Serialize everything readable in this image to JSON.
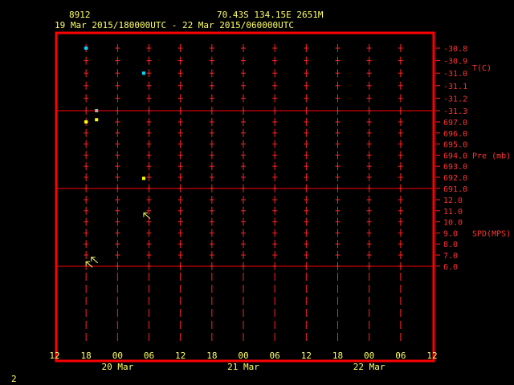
{
  "header": {
    "station_id": "8912",
    "location": "70.43S   134.15E   2651M",
    "time_range": "19 Mar 2015/180000UTC - 22 Mar 2015/060000UTC"
  },
  "footer": {
    "page_number": "2"
  },
  "colors": {
    "frame": "#ff0000",
    "header_text": "#ffff66",
    "temperature_point": "#00d8ff",
    "pressure_point": "#ffff00",
    "temperature_gray": "#aaaaaa",
    "wind_arrow": "#ffff66"
  },
  "chart_data": {
    "type": "scatter",
    "x_axis": {
      "unit": "hour (UTC)",
      "start": "2015-03-19 12:00",
      "end": "2015-03-22 12:00",
      "tick_labels": [
        "12",
        "18",
        "00",
        "06",
        "12",
        "18",
        "00",
        "06",
        "12",
        "18",
        "00",
        "06",
        "12"
      ],
      "date_labels": [
        "20 Mar",
        "21 Mar",
        "22 Mar"
      ]
    },
    "panels": [
      {
        "name": "temperature",
        "label": "T(C)",
        "tick_labels": [
          "-30.8",
          "-30.9",
          "-31.0",
          "-31.1",
          "-31.2",
          "-31.3"
        ],
        "ylim": [
          -31.3,
          -30.8
        ],
        "points": [
          {
            "x": "2015-03-19 18:00",
            "y": -30.8,
            "color": "#00d8ff"
          },
          {
            "x": "2015-03-20 05:00",
            "y": -31.0,
            "color": "#00d8ff"
          },
          {
            "x": "2015-03-19 20:00",
            "y": -31.3,
            "color": "#aaaaaa"
          }
        ]
      },
      {
        "name": "pressure",
        "label": "Pre (mb)",
        "tick_labels": [
          "697.0",
          "696.0",
          "695.0",
          "694.0",
          "693.0",
          "692.0",
          "691.0"
        ],
        "ylim": [
          691.0,
          697.0
        ],
        "points": [
          {
            "x": "2015-03-19 18:00",
            "y": 697.0,
            "color": "#ffff00"
          },
          {
            "x": "2015-03-19 20:00",
            "y": 697.2,
            "color": "#ffff00"
          },
          {
            "x": "2015-03-20 05:00",
            "y": 691.9,
            "color": "#ffff00"
          }
        ]
      },
      {
        "name": "wind_speed",
        "label": "SPD(MPS)",
        "tick_labels": [
          "12.0",
          "11.0",
          "10.0",
          "9.0",
          "8.0",
          "7.0",
          "6.0"
        ],
        "ylim": [
          6.0,
          12.0
        ],
        "arrows": [
          {
            "x": "2015-03-20 05:00",
            "y": 10.8
          },
          {
            "x": "2015-03-19 19:00",
            "y": 6.8
          },
          {
            "x": "2015-03-19 18:00",
            "y": 6.4
          }
        ]
      }
    ]
  }
}
